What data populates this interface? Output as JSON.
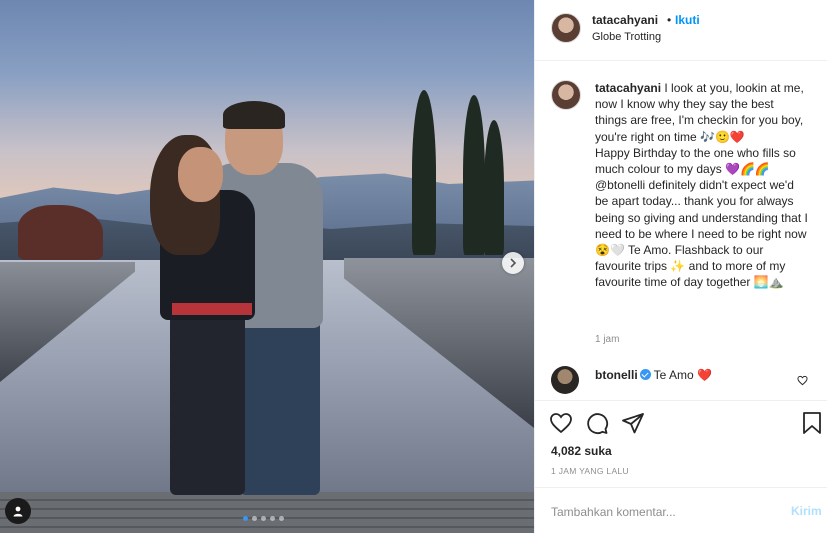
{
  "post": {
    "carousel": {
      "total": 5,
      "active_index": 0
    }
  },
  "header": {
    "username": "tatacahyani",
    "bullet": "•",
    "follow_label": "Ikuti",
    "location": "Globe Trotting"
  },
  "caption": {
    "username": "tatacahyani",
    "text": " I look at you, lookin at me,\nnow I know why they say the best things are free, I'm checkin for you boy, you're right on time 🎶🙂❤️\nHappy Birthday to the one who fills so much colour to my days 💜🌈🌈\n@btonelli definitely didn't expect we'd be apart today... thank you for always being so giving and understanding that I need to be where I need to be right now😵🤍 Te Amo. Flashback to our favourite trips ✨ and to more of my favourite time of day together 🌅⛰️",
    "time": "1 jam"
  },
  "comment": {
    "username": "btonelli",
    "text": "Te Amo ❤️"
  },
  "stats": {
    "likes": "4,082 suka",
    "posted_ago": "1 JAM YANG LALU"
  },
  "add_comment": {
    "placeholder": "Tambahkan komentar...",
    "post_label": "Kirim"
  },
  "colors": {
    "link_blue": "#0095f6",
    "verified_blue": "#3897f0",
    "muted": "#8e8e8e",
    "heart_red": "#c8102e"
  },
  "icons": [
    "chevron-right-icon",
    "user-tag-icon",
    "heart-icon",
    "comment-icon",
    "share-icon",
    "bookmark-icon",
    "verified-icon"
  ]
}
